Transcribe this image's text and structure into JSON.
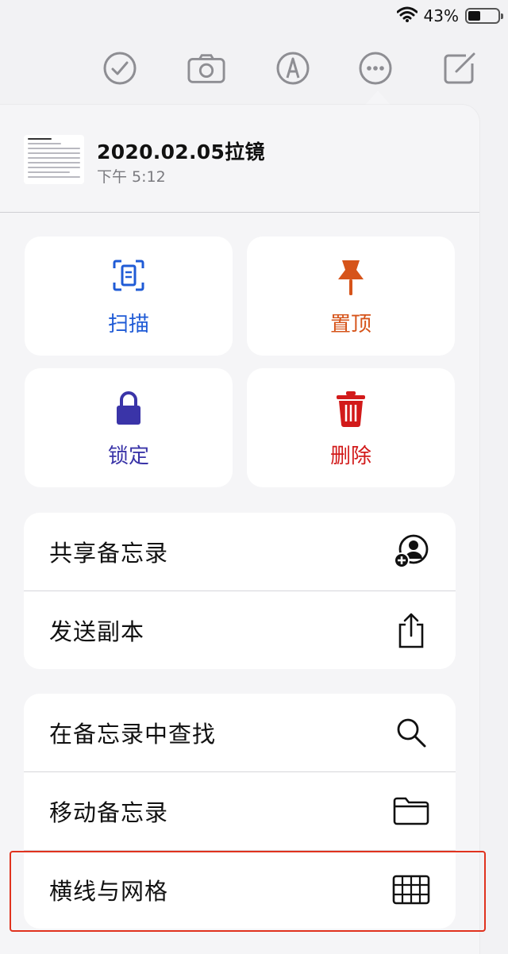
{
  "status_bar": {
    "battery_percent": "43%",
    "battery_level": 0.43
  },
  "toolbar": {
    "icons": [
      "checklist-icon",
      "camera-icon",
      "markup-icon",
      "more-icon",
      "compose-icon"
    ]
  },
  "note": {
    "title": "2020.02.05拉镜",
    "time": "下午 5:12"
  },
  "quick_actions": [
    {
      "label": "扫描",
      "icon": "scan-icon",
      "color": "#1f5bd6"
    },
    {
      "label": "置顶",
      "icon": "pin-icon",
      "color": "#d6541a"
    },
    {
      "label": "锁定",
      "icon": "lock-icon",
      "color": "#3a34a8"
    },
    {
      "label": "删除",
      "icon": "trash-icon",
      "color": "#d21a1a"
    }
  ],
  "menu_group_1": [
    {
      "label": "共享备忘录",
      "icon": "share-person-icon"
    },
    {
      "label": "发送副本",
      "icon": "share-icon"
    }
  ],
  "menu_group_2": [
    {
      "label": "在备忘录中查找",
      "icon": "search-icon"
    },
    {
      "label": "移动备忘录",
      "icon": "folder-icon"
    },
    {
      "label": "横线与网格",
      "icon": "grid-icon"
    }
  ],
  "colors": {
    "highlight_border": "#e0321e",
    "background": "#f2f2f4"
  }
}
